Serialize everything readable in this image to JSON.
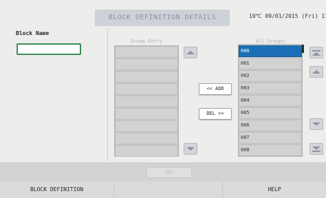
{
  "header": {
    "title": "BLOCK DEFINITION DETAILS",
    "temperature": "10℃",
    "datetime": "09/01/2015 (Fri) 11:5"
  },
  "block_name": {
    "label": "Block Name",
    "value": ""
  },
  "group_entry": {
    "header": "Group Entry",
    "rows": [
      "",
      "",
      "",
      "",
      "",
      "",
      "",
      "",
      ""
    ]
  },
  "all_groups": {
    "header": "All Groups",
    "rows": [
      "000",
      "001",
      "002",
      "003",
      "004",
      "005",
      "006",
      "007",
      "008"
    ],
    "selected_index": 0
  },
  "actions": {
    "add": "<< ADD",
    "del": "DEL >>"
  },
  "set_button": "SET",
  "footer": {
    "left": "BLOCK DEFINITION",
    "middle": "",
    "right": "HELP"
  },
  "icons": {
    "scroll_up": "triangle-up-icon",
    "scroll_down": "triangle-down-icon",
    "page_up": "double-up-icon",
    "page_down": "double-down-icon"
  }
}
